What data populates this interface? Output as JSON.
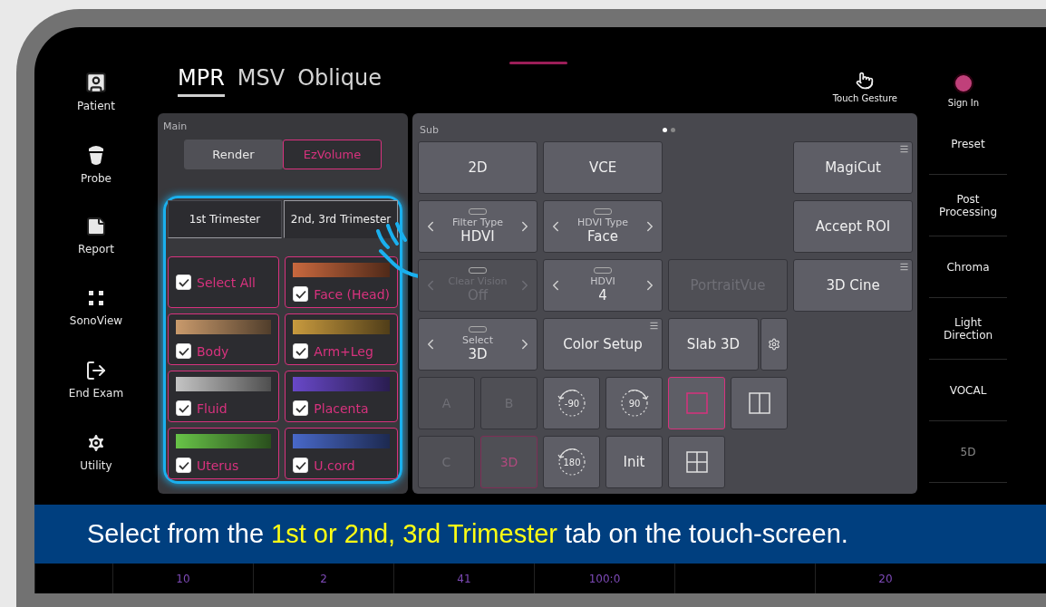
{
  "left_nav": [
    {
      "label": "Patient"
    },
    {
      "label": "Probe"
    },
    {
      "label": "Report"
    },
    {
      "label": "SonoView"
    },
    {
      "label": "End Exam"
    },
    {
      "label": "Utility"
    }
  ],
  "view_tabs": [
    {
      "label": "MPR",
      "selected": true
    },
    {
      "label": "MSV",
      "selected": false
    },
    {
      "label": "Oblique",
      "selected": false
    }
  ],
  "touch_gesture": {
    "label": "Touch Gesture"
  },
  "sign_in": {
    "label": "Sign In"
  },
  "main_panel": {
    "title": "Main",
    "modes": [
      {
        "label": "Render",
        "selected": false
      },
      {
        "label": "EzVolume",
        "selected": true
      }
    ],
    "trimester_tabs": [
      {
        "label": "1st Trimester",
        "selected": false
      },
      {
        "label": "2nd, 3rd Trimester",
        "selected": true
      }
    ],
    "tissues": [
      {
        "label": "Select All",
        "checked": true
      },
      {
        "label": "Face (Head)",
        "checked": true,
        "color": "#c8683e"
      },
      {
        "label": "Body",
        "checked": true,
        "color": "#c99a6c"
      },
      {
        "label": "Arm+Leg",
        "checked": true,
        "color": "#c89a3e"
      },
      {
        "label": "Fluid",
        "checked": true,
        "color": "#c4c4c4"
      },
      {
        "label": "Placenta",
        "checked": true,
        "color": "#6848c8"
      },
      {
        "label": "Uterus",
        "checked": true,
        "color": "#68c448"
      },
      {
        "label": "U.cord",
        "checked": true,
        "color": "#4868c8"
      }
    ]
  },
  "sub_panel": {
    "title": "Sub",
    "pages": [
      {
        "selected": true
      },
      {
        "selected": false
      }
    ],
    "items": [
      {
        "kind": "button",
        "label": "2D",
        "menu": false,
        "disabled": false,
        "selected": false
      },
      {
        "kind": "button",
        "label": "VCE",
        "menu": false,
        "disabled": false,
        "selected": false
      },
      {
        "kind": "blank"
      },
      {
        "kind": "button",
        "label": "MagiCut",
        "menu": true,
        "disabled": false,
        "selected": false
      },
      {
        "kind": "spinner",
        "caption": "Filter Type",
        "value": "HDVI",
        "disabled": false,
        "selected": false
      },
      {
        "kind": "spinner",
        "caption": "HDVI Type",
        "value": "Face",
        "disabled": false,
        "selected": false
      },
      {
        "kind": "blank"
      },
      {
        "kind": "button",
        "label": "Accept ROI",
        "menu": false,
        "disabled": false,
        "selected": false
      },
      {
        "kind": "spinner",
        "caption": "Clear Vision",
        "value": "Off",
        "disabled": true,
        "selected": false
      },
      {
        "kind": "spinner",
        "caption": "HDVI",
        "value": "4",
        "disabled": false,
        "selected": false
      },
      {
        "kind": "button",
        "label": "PortraitVue",
        "menu": false,
        "disabled": true,
        "selected": false
      },
      {
        "kind": "button",
        "label": "3D Cine",
        "menu": true,
        "disabled": false,
        "selected": false
      },
      {
        "kind": "spinner",
        "caption": "Select",
        "value": "3D",
        "disabled": false,
        "selected": false
      },
      {
        "kind": "button",
        "label": "Color Setup",
        "menu": true,
        "disabled": false,
        "selected": false
      },
      {
        "kind": "split",
        "label": "Slab 3D",
        "disabled": false,
        "selected": false
      },
      {
        "kind": "blank"
      },
      {
        "kind": "tile",
        "label": "A",
        "disabled": true,
        "selected": false
      },
      {
        "kind": "tile",
        "label": "B",
        "disabled": true,
        "selected": false
      },
      {
        "kind": "ccw",
        "label": "-90",
        "disabled": false,
        "selected": false
      },
      {
        "kind": "cw",
        "label": "90",
        "disabled": false,
        "selected": false
      },
      {
        "kind": "single",
        "disabled": false,
        "selected": true
      },
      {
        "kind": "dual",
        "disabled": false,
        "selected": false
      },
      {
        "kind": "gap"
      },
      {
        "kind": "tile",
        "label": "C",
        "disabled": true,
        "selected": false
      },
      {
        "kind": "tile",
        "label": "3D",
        "disabled": true,
        "selected": true
      },
      {
        "kind": "ccw",
        "label": "180",
        "disabled": false,
        "selected": false
      },
      {
        "kind": "tile",
        "label": "Init",
        "disabled": false,
        "selected": false
      },
      {
        "kind": "quad",
        "disabled": false,
        "selected": false
      }
    ]
  },
  "right_nav": [
    {
      "label": "Preset",
      "disabled": false
    },
    {
      "label": "Post Processing",
      "disabled": false
    },
    {
      "label": "Chroma",
      "disabled": false
    },
    {
      "label": "Light Direction",
      "disabled": false
    },
    {
      "label": "VOCAL",
      "disabled": false
    },
    {
      "label": "5D",
      "disabled": true
    }
  ],
  "caption": "Select from the **1st or 2nd, 3rd Trimester** tab on the touch-screen.",
  "bottom_controls": [
    {
      "kind": "empty"
    },
    {
      "kind": "value",
      "value": "10"
    },
    {
      "kind": "value",
      "value": "2"
    },
    {
      "kind": "value",
      "value": "41"
    },
    {
      "kind": "value",
      "value": "100:0"
    },
    {
      "kind": "empty"
    },
    {
      "kind": "value",
      "value": "20"
    }
  ]
}
